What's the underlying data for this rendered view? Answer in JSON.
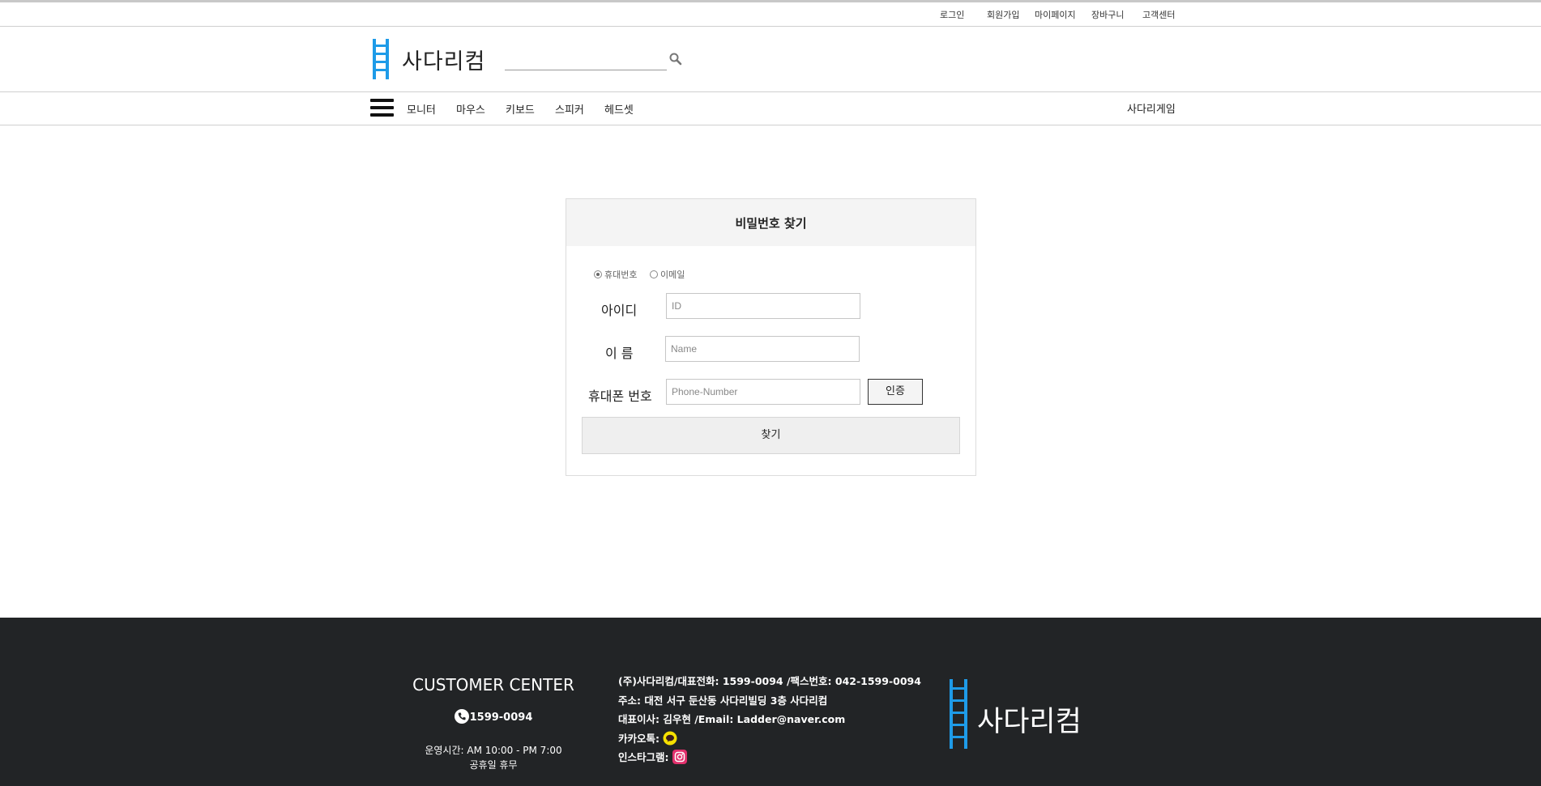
{
  "top_links": [
    "로그인",
    "회원가입",
    "마이페이지",
    "장바구니",
    "고객센터"
  ],
  "header": {
    "logo_text": "사다리컴",
    "search_placeholder": ""
  },
  "nav": {
    "items": [
      "모니터",
      "마우스",
      "키보드",
      "스피커",
      "헤드셋"
    ],
    "right_link": "사다리게임"
  },
  "panel": {
    "title": "비밀번호 찾기",
    "radio_options": [
      {
        "label": "휴대번호",
        "checked": true
      },
      {
        "label": "이메일",
        "checked": false
      }
    ],
    "fields": {
      "id_label": "아이디",
      "id_placeholder": "ID",
      "name_label": "이 름",
      "name_placeholder": "Name",
      "phone_label": "휴대폰 번호",
      "phone_placeholder": "Phone-Number"
    },
    "verify_button": "인증",
    "find_button": "찾기"
  },
  "footer": {
    "cc_title": "CUSTOMER CENTER",
    "cc_phone": "1599-0094",
    "cc_hours": "운영시간: AM 10:00 - PM 7:00",
    "cc_holiday": "공휴일 휴무",
    "info_line1": "(주)사다리컴/대표전화: 1599-0094 /팩스번호: 042-1599-0094",
    "info_line2": "주소: 대전 서구 둔산동 사다리빌딩 3층 사다리컴",
    "info_line3": "대표이사: 김우현 /Email: Ladder@naver.com",
    "kakao_label": "카카오톡:",
    "insta_label": "인스타그램:",
    "logo_text": "사다리컴"
  },
  "colors": {
    "logo_blue": "#1e9be8",
    "footer_bg": "#222426",
    "kakao_yellow": "#f6e000",
    "insta_pink": "#e1306c"
  }
}
